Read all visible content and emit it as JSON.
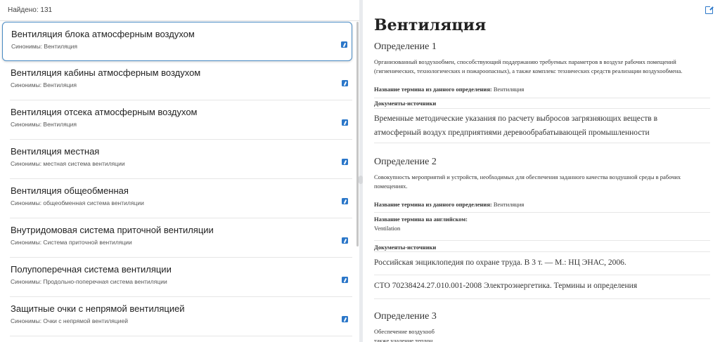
{
  "list": {
    "found_text": "Найдено: 131",
    "items": [
      {
        "title": "Вентиляция блока атмосферным воздухом",
        "synonyms": "Синонимы: Вентиляция"
      },
      {
        "title": "Вентиляция кабины атмосферным воздухом",
        "synonyms": "Синонимы: Вентиляция"
      },
      {
        "title": "Вентиляция отсека атмосферным воздухом",
        "synonyms": "Синонимы: Вентиляция"
      },
      {
        "title": "Вентиляция местная",
        "synonyms": "Синонимы: местная система вентиляции"
      },
      {
        "title": "Вентиляция общеобменная",
        "synonyms": "Синонимы: общеобменная система вентиляции"
      },
      {
        "title": "Внутридомовая система приточной вентиляции",
        "synonyms": "Синонимы: Система приточной вентиляции"
      },
      {
        "title": "Полупоперечная система вентиляции",
        "synonyms": "Синонимы: Продольно-поперечная система вентиляции"
      },
      {
        "title": "Защитные очки с непрямой вентиляцией",
        "synonyms": "Синонимы: Очки с непрямой вентиляцией"
      }
    ]
  },
  "detail": {
    "title": "Вентиляция",
    "definitions": [
      {
        "heading": "Определение 1",
        "text": "Организованный воздухообмен, способствующий поддержанию требуемых параметров в воздухе рабочих помещений (гигиенических, технологических и пожароопасных), а также комплекс технических средств реализации воздухообмена.",
        "term_label": "Название термина из данного определения:",
        "term_value": "Вентиляция",
        "docs_label": "Документы-источники",
        "docs": [
          "Временные методические указания по расчету выбросов загрязняющих веществ в атмосферный воздух предприятиями деревообрабатывающей промышленности"
        ]
      },
      {
        "heading": "Определение 2",
        "text": "Совокупность мероприятий и устройств, необходимых для обеспечения заданного качества воздушной среды в рабочих помещениях.",
        "term_label": "Название термина из данного определения:",
        "term_value": "Вентиляция",
        "english_label": "Название термина на английском:",
        "english_value": "Ventilation",
        "docs_label": "Документы-источники",
        "docs": [
          "Российская энциклопедия по охране труда. В 3 т. — М.: НЦ ЭНАС, 2006.",
          "СТО 70238424.27.010.001-2008 Электроэнергетика. Термины и определения"
        ]
      },
      {
        "heading": "Определение 3",
        "text_lines": [
          "Обеспечение воздухооб",
          "также удаление теплон"
        ]
      }
    ]
  },
  "colors": {
    "accent": "#2b77c9",
    "selected_border": "#4a8bc4"
  }
}
